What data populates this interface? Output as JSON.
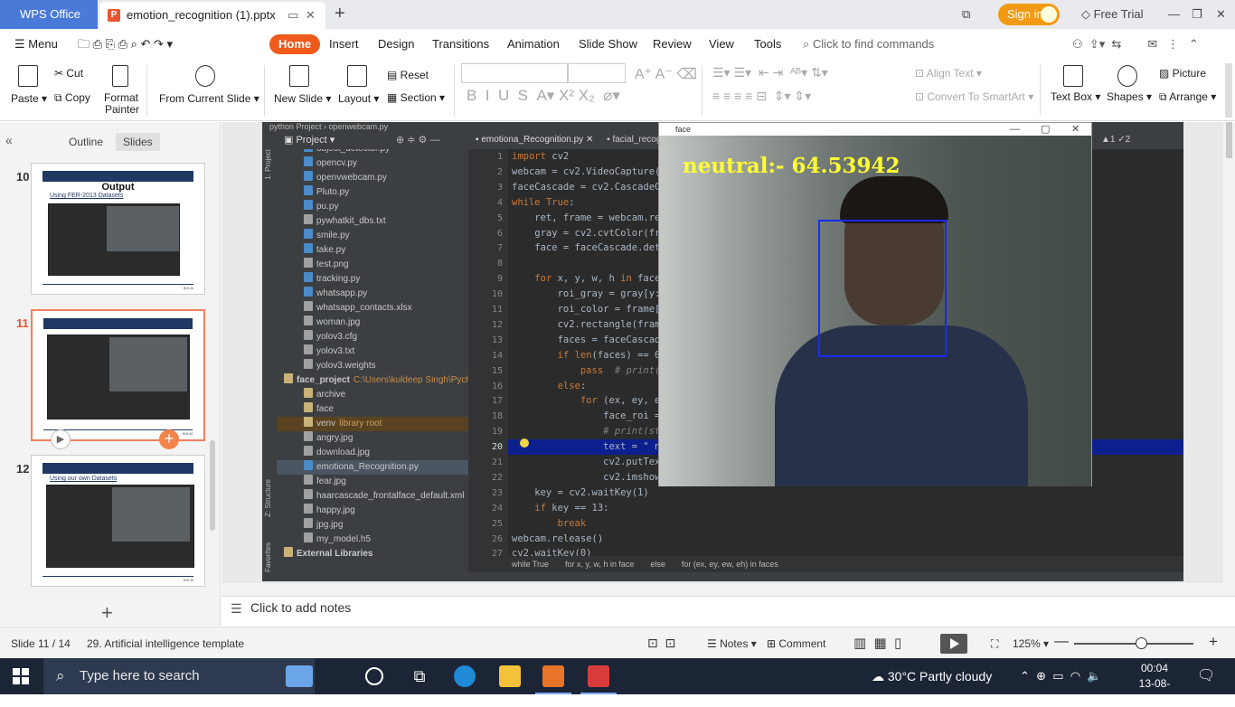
{
  "titlebar": {
    "app_tab": "WPS Office",
    "doc_tab": "emotion_recognition (1).pptx",
    "free_trial": "Free Trial",
    "sign_in": "Sign in"
  },
  "menubar": {
    "menu_label": "Menu",
    "tabs": [
      "Home",
      "Insert",
      "Design",
      "Transitions",
      "Animation",
      "Slide Show",
      "Review",
      "View",
      "Tools"
    ],
    "search_placeholder": "Click to find commands"
  },
  "ribbon": {
    "paste": "Paste",
    "cut": "Cut",
    "copy": "Copy",
    "format_painter_1": "Format",
    "format_painter_2": "Painter",
    "from_current_slide": "From Current Slide",
    "new_slide": "New Slide",
    "layout": "Layout",
    "reset": "Reset",
    "section": "Section",
    "align_text": "Align Text",
    "convert_to_smartart": "Convert To SmartArt",
    "text_box": "Text Box",
    "shapes": "Shapes",
    "picture": "Picture",
    "arrange": "Arrange"
  },
  "sidebar": {
    "tabs": [
      "Outline",
      "Slides"
    ],
    "active_tab": "Slides",
    "slides": [
      {
        "number": "10",
        "title": "Output",
        "subtitle": "Using FER-2013 Datasets",
        "overlay": "happy:- 99.6983"
      },
      {
        "number": "11",
        "title": "",
        "subtitle": "",
        "overlay": "neutral:- 64.53942"
      },
      {
        "number": "12",
        "title": "",
        "subtitle": "Using our own Datasets",
        "overlay": "happy:- 97.0480"
      }
    ],
    "footer_text": "BHLM"
  },
  "ide": {
    "top_path": "python Project  ›  openwebcam.py",
    "project_label": "Project",
    "side_tabs": [
      "1: Project",
      "2: Favorites",
      "Z: Structure"
    ],
    "code_tabs": [
      "emotiona_Recognition.py",
      "facial_recogn"
    ],
    "warnings": "▲1  ✓2",
    "tree": [
      {
        "name": "object_detector.py",
        "kind": "py",
        "indent": 2
      },
      {
        "name": "opencv.py",
        "kind": "py",
        "indent": 2
      },
      {
        "name": "openvwebcam.py",
        "kind": "py",
        "indent": 2
      },
      {
        "name": "Pluto.py",
        "kind": "py",
        "indent": 2
      },
      {
        "name": "pu.py",
        "kind": "py",
        "indent": 2
      },
      {
        "name": "pywhatkit_dbs.txt",
        "kind": "txt",
        "indent": 2
      },
      {
        "name": "smile.py",
        "kind": "py",
        "indent": 2
      },
      {
        "name": "take.py",
        "kind": "py",
        "indent": 2
      },
      {
        "name": "test.png",
        "kind": "img",
        "indent": 2
      },
      {
        "name": "tracking.py",
        "kind": "py",
        "indent": 2
      },
      {
        "name": "whatsapp.py",
        "kind": "py",
        "indent": 2
      },
      {
        "name": "whatsapp_contacts.xlsx",
        "kind": "txt",
        "indent": 2
      },
      {
        "name": "woman.jpg",
        "kind": "img",
        "indent": 2
      },
      {
        "name": "yolov3.cfg",
        "kind": "txt",
        "indent": 2
      },
      {
        "name": "yolov3.txt",
        "kind": "txt",
        "indent": 2
      },
      {
        "name": "yolov3.weights",
        "kind": "txt",
        "indent": 2
      },
      {
        "name": "face_project",
        "kind": "dir",
        "indent": 0,
        "extra": "C:\\Users\\kuldeep Singh\\Pycha"
      },
      {
        "name": "archive",
        "kind": "dir",
        "indent": 2
      },
      {
        "name": "face",
        "kind": "dir",
        "indent": 2
      },
      {
        "name": "venv",
        "kind": "dir",
        "indent": 2,
        "extra": "library root"
      },
      {
        "name": "angry.jpg",
        "kind": "img",
        "indent": 2
      },
      {
        "name": "download.jpg",
        "kind": "img",
        "indent": 2
      },
      {
        "name": "emotiona_Recognition.py",
        "kind": "py",
        "indent": 2
      },
      {
        "name": "fear.jpg",
        "kind": "img",
        "indent": 2
      },
      {
        "name": "haarcascade_frontalface_default.xml",
        "kind": "txt",
        "indent": 2
      },
      {
        "name": "happy.jpg",
        "kind": "img",
        "indent": 2
      },
      {
        "name": "jpg.jpg",
        "kind": "img",
        "indent": 2
      },
      {
        "name": "my_model.h5",
        "kind": "txt",
        "indent": 2
      },
      {
        "name": "External Libraries",
        "kind": "dir",
        "indent": 0
      }
    ],
    "code_lines": [
      {
        "n": "1",
        "t": "import cv2"
      },
      {
        "n": "2",
        "t": "webcam = cv2.VideoCapture(0"
      },
      {
        "n": "3",
        "t": "faceCascade = cv2.CascadeCla"
      },
      {
        "n": "4",
        "t": "while True:"
      },
      {
        "n": "5",
        "t": "    ret, frame = webcam.rea"
      },
      {
        "n": "6",
        "t": "    gray = cv2.cvtColor(fra"
      },
      {
        "n": "7",
        "t": "    face = faceCascade.dete"
      },
      {
        "n": "8",
        "t": ""
      },
      {
        "n": "9",
        "t": "    for x, y, w, h in face:"
      },
      {
        "n": "10",
        "t": "        roi_gray = gray[y:y"
      },
      {
        "n": "11",
        "t": "        roi_color = frame[y"
      },
      {
        "n": "12",
        "t": "        cv2.rectangle(frame"
      },
      {
        "n": "13",
        "t": "        faces = faceCascade"
      },
      {
        "n": "14",
        "t": "        if len(faces) == 0:"
      },
      {
        "n": "15",
        "t": "            pass  # print(\""
      },
      {
        "n": "16",
        "t": "        else:"
      },
      {
        "n": "17",
        "t": "            for (ex, ey, ew"
      },
      {
        "n": "18",
        "t": "                face_roi = "
      },
      {
        "n": "19",
        "t": "                # print(str"
      },
      {
        "n": "20",
        "t": "                text = \" ne"
      },
      {
        "n": "21",
        "t": "                cv2.putText"
      },
      {
        "n": "22",
        "t": "                cv2.imshow("
      },
      {
        "n": "23",
        "t": "    key = cv2.waitKey(1)"
      },
      {
        "n": "24",
        "t": "    if key == 13:"
      },
      {
        "n": "25",
        "t": "        break"
      },
      {
        "n": "26",
        "t": "webcam.release()"
      },
      {
        "n": "27",
        "t": "cv2.waitKey(0)"
      }
    ],
    "breadcrumb": [
      "while True",
      "for x, y, w, h in face",
      "else",
      "for (ex, ey, ew, eh) in faces"
    ]
  },
  "face_window": {
    "title": "face",
    "emotion_label": "neutral:- 64.53942"
  },
  "notes": {
    "placeholder": "Click to add notes"
  },
  "statusbar": {
    "slide_indicator": "Slide 11 / 14",
    "template": "29. Artificial intelligence template",
    "notes": "Notes",
    "comment": "Comment",
    "zoom": "125%"
  },
  "taskbar": {
    "search_placeholder": "Type here to search",
    "weather": "30°C  Partly cloudy",
    "time": "00:04",
    "date": "13-08-2022"
  },
  "colors": {
    "wps_blue": "#4a7ad8",
    "home_orange": "#ef5a1c",
    "signin_orange": "#f29a14",
    "ide_dark": "#2b2b2b",
    "face_box": "#1a28ff",
    "emotion_text": "#ffff33"
  }
}
